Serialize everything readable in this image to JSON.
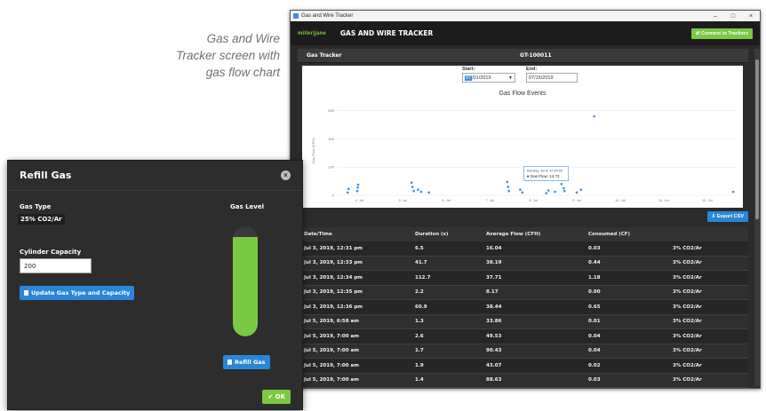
{
  "caption": {
    "line1": "Gas and Wire",
    "line2": "Tracker screen with",
    "line3": "gas flow chart"
  },
  "window": {
    "titlebar": "Gas and Wire Tracker",
    "minimize": "–",
    "maximize": "□",
    "close": "×",
    "brand": "miller|jane",
    "app_title": "GAS AND WIRE TRACKER",
    "connect_button": "⇄ Connect to Trackers"
  },
  "tracker": {
    "label": "Gas Tracker",
    "id": "GT-100011"
  },
  "dates": {
    "start_label": "Start:",
    "start_highlight": "07",
    "start_rest": "/01/2019",
    "end_label": "End:",
    "end_value": "07/15/2019"
  },
  "chart_data": {
    "type": "scatter",
    "title": "Gas Flow Events",
    "ylabel": "Gas Flow (CFH)",
    "y_ticks": [
      "0",
      "200",
      "400",
      "600"
    ],
    "x_ticks": [
      "4. Jul",
      "5. Jul",
      "6. Jul",
      "7. Jul",
      "8. Jul",
      "9. Jul",
      "10. Jul",
      "11. Jul",
      "12. Jul"
    ],
    "ylim": [
      0,
      680
    ],
    "xlim": [
      3.5,
      12.7
    ],
    "color": "#3c8fd8",
    "tooltip": {
      "line1": "Monday, Jul 8, 10:34:50",
      "line2": "● Gas Flow: 14.72"
    },
    "points": [
      {
        "x": 3.73,
        "y": 20
      },
      {
        "x": 3.75,
        "y": 45
      },
      {
        "x": 3.95,
        "y": 30
      },
      {
        "x": 3.96,
        "y": 55
      },
      {
        "x": 3.97,
        "y": 75
      },
      {
        "x": 5.2,
        "y": 90
      },
      {
        "x": 5.22,
        "y": 60
      },
      {
        "x": 5.25,
        "y": 30
      },
      {
        "x": 5.35,
        "y": 40
      },
      {
        "x": 5.42,
        "y": 25
      },
      {
        "x": 5.6,
        "y": 20
      },
      {
        "x": 7.4,
        "y": 95
      },
      {
        "x": 7.42,
        "y": 60
      },
      {
        "x": 7.44,
        "y": 30
      },
      {
        "x": 7.7,
        "y": 40
      },
      {
        "x": 7.75,
        "y": 20
      },
      {
        "x": 8.3,
        "y": 14.72
      },
      {
        "x": 8.35,
        "y": 35
      },
      {
        "x": 8.5,
        "y": 25
      },
      {
        "x": 8.65,
        "y": 80
      },
      {
        "x": 8.7,
        "y": 50
      },
      {
        "x": 8.72,
        "y": 30
      },
      {
        "x": 9.0,
        "y": 20
      },
      {
        "x": 9.1,
        "y": 40
      },
      {
        "x": 9.4,
        "y": 560
      },
      {
        "x": 12.6,
        "y": 25
      }
    ]
  },
  "export_button": "⇩ Export CSV",
  "table": {
    "headers": [
      "Date/Time",
      "Duration (s)",
      "Average Flow (CFH)",
      "Consumed (CF)",
      ""
    ],
    "rows": [
      [
        "Jul 3, 2019, 12:31 pm",
        "6.5",
        "16.04",
        "0.03",
        "3% CO2/Ar"
      ],
      [
        "Jul 3, 2019, 12:33 pm",
        "41.7",
        "38.19",
        "0.44",
        "3% CO2/Ar"
      ],
      [
        "Jul 3, 2019, 12:34 pm",
        "112.7",
        "37.71",
        "1.18",
        "3% CO2/Ar"
      ],
      [
        "Jul 3, 2019, 12:35 pm",
        "2.2",
        "8.17",
        "0.00",
        "3% CO2/Ar"
      ],
      [
        "Jul 3, 2019, 12:36 pm",
        "60.9",
        "38.44",
        "0.65",
        "3% CO2/Ar"
      ],
      [
        "Jul 5, 2019, 6:58 am",
        "1.3",
        "33.86",
        "0.01",
        "3% CO2/Ar"
      ],
      [
        "Jul 5, 2019, 7:00 am",
        "2.6",
        "49.53",
        "0.04",
        "3% CO2/Ar"
      ],
      [
        "Jul 5, 2019, 7:00 am",
        "1.7",
        "90.43",
        "0.04",
        "3% CO2/Ar"
      ],
      [
        "Jul 5, 2019, 7:00 am",
        "1.9",
        "43.07",
        "0.02",
        "3% CO2/Ar"
      ],
      [
        "Jul 5, 2019, 7:00 am",
        "1.4",
        "88.63",
        "0.03",
        "3% CO2/Ar"
      ]
    ]
  },
  "dialog": {
    "title": "Refill Gas",
    "close": "×",
    "gas_type_label": "Gas Type",
    "gas_type_value": "25% CO2/Ar",
    "capacity_label": "Cylinder Capacity",
    "capacity_value": "200",
    "update_button": "Update Gas Type and Capacity",
    "gas_level_label": "Gas Level",
    "gas_level_fraction": 0.9,
    "refill_button": "Refill Gas",
    "ok_button": "✔ OK"
  }
}
